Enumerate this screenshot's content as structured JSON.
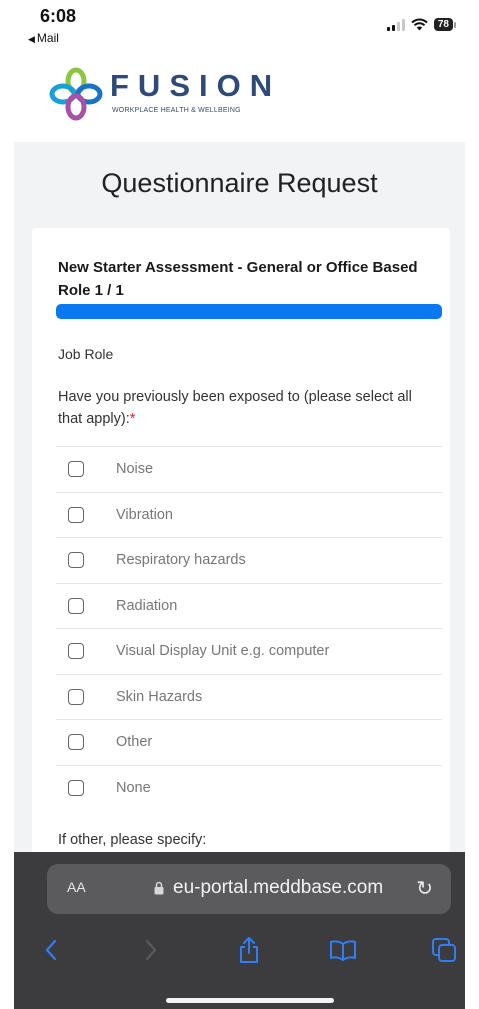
{
  "status_bar": {
    "time": "6:08",
    "back_label": "Mail",
    "battery": "78"
  },
  "header": {
    "brand": "FUSION",
    "tagline": "WORKPLACE HEALTH & WELLBEING"
  },
  "page": {
    "title": "Questionnaire Request"
  },
  "form": {
    "section_title": "New Starter Assessment - General or Office Based Role 1 / 1",
    "progress": 1.0,
    "job_role_label": "Job Role",
    "question": "Have you previously been exposed to (please select all that apply):",
    "required_mark": "*",
    "options": [
      {
        "label": "Noise",
        "checked": false
      },
      {
        "label": "Vibration",
        "checked": false
      },
      {
        "label": "Respiratory hazards",
        "checked": false
      },
      {
        "label": "Radiation",
        "checked": false
      },
      {
        "label": "Visual Display Unit e.g. computer",
        "checked": false
      },
      {
        "label": "Skin Hazards",
        "checked": false
      },
      {
        "label": "Other",
        "checked": false
      },
      {
        "label": "None",
        "checked": false
      }
    ],
    "other_label": "If other, please specify:"
  },
  "browser": {
    "text_size_label": "AA",
    "url": "eu-portal.meddbase.com",
    "toolbar_icons": [
      "back-icon",
      "forward-icon",
      "share-icon",
      "bookmarks-icon",
      "tabs-icon"
    ]
  },
  "colors": {
    "accent": "#0a78f0",
    "brand": "#2d4a7a",
    "required": "#e02020",
    "toolbar_icon": "#2f7ef5"
  }
}
